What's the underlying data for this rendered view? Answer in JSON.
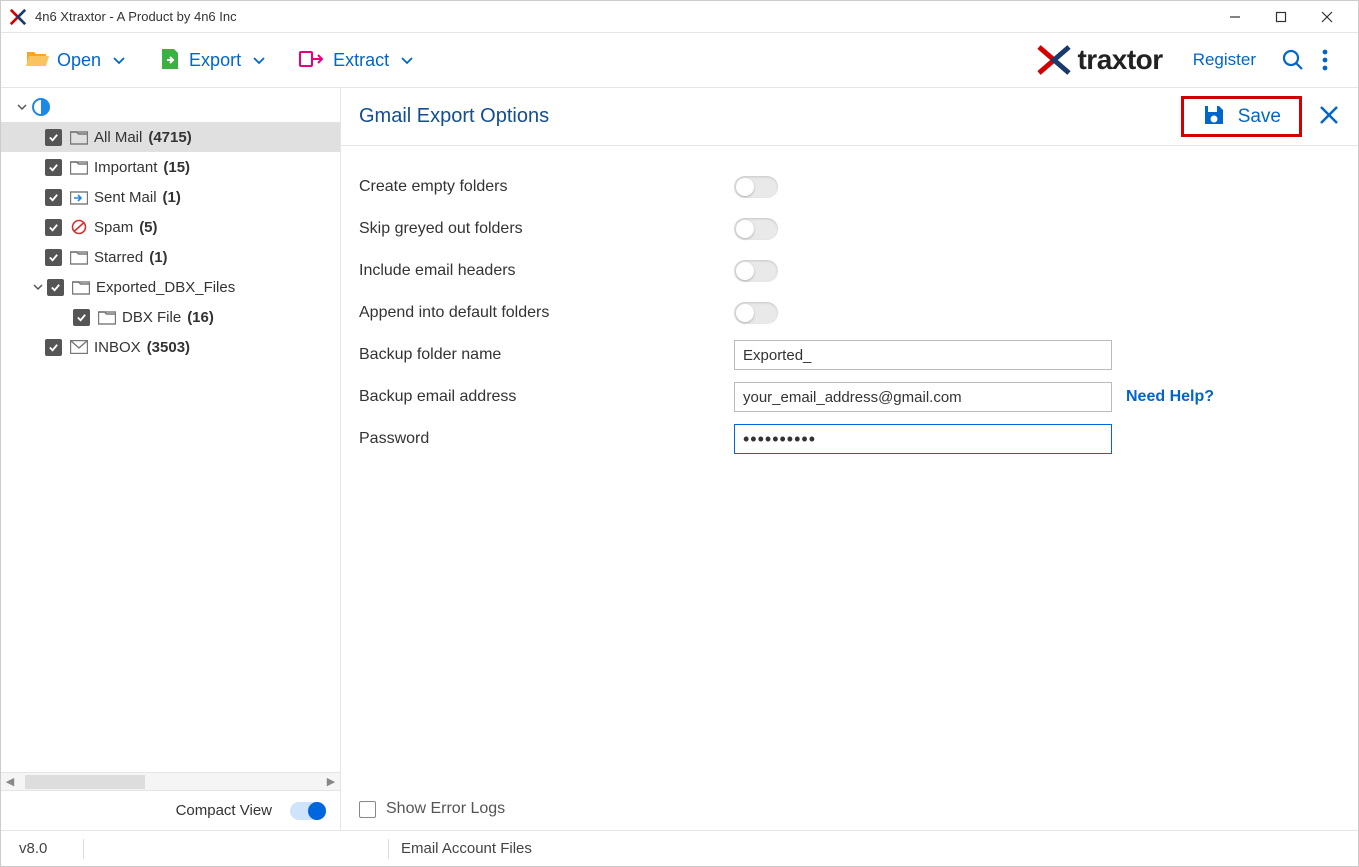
{
  "window": {
    "title": "4n6 Xtraxtor - A Product by 4n6 Inc"
  },
  "toolbar": {
    "open_label": "Open",
    "export_label": "Export",
    "extract_label": "Extract",
    "register_label": "Register",
    "logo_text": "traxtor"
  },
  "sidebar": {
    "items": [
      {
        "name": "All Mail",
        "count": "(4715)",
        "icon": "folder",
        "indent": 44,
        "caret": false,
        "selected": true
      },
      {
        "name": "Important",
        "count": "(15)",
        "icon": "folder",
        "indent": 44,
        "caret": false,
        "selected": false
      },
      {
        "name": "Sent Mail",
        "count": "(1)",
        "icon": "sent",
        "indent": 44,
        "caret": false,
        "selected": false
      },
      {
        "name": "Spam",
        "count": "(5)",
        "icon": "spam",
        "indent": 44,
        "caret": false,
        "selected": false
      },
      {
        "name": "Starred",
        "count": "(1)",
        "icon": "folder",
        "indent": 44,
        "caret": false,
        "selected": false
      },
      {
        "name": "Exported_DBX_Files",
        "count": "",
        "icon": "folder",
        "indent": 44,
        "caret": true,
        "selected": false
      },
      {
        "name": "DBX File",
        "count": "(16)",
        "icon": "folder",
        "indent": 72,
        "caret": false,
        "selected": false
      },
      {
        "name": "INBOX",
        "count": "(3503)",
        "icon": "inbox",
        "indent": 44,
        "caret": false,
        "selected": false
      }
    ],
    "compact_label": "Compact View"
  },
  "content": {
    "title": "Gmail Export Options",
    "save_label": "Save",
    "options": [
      {
        "label": "Create empty folders"
      },
      {
        "label": "Skip greyed out folders"
      },
      {
        "label": "Include email headers"
      },
      {
        "label": "Append into default folders"
      }
    ],
    "backup_folder_label": "Backup folder name",
    "backup_folder_value": "Exported_",
    "backup_email_label": "Backup email address",
    "backup_email_value": "your_email_address@gmail.com",
    "help_label": "Need Help?",
    "password_label": "Password",
    "password_value": "••••••••••",
    "show_error_logs_label": "Show Error Logs"
  },
  "status": {
    "version": "v8.0",
    "info": "Email Account Files"
  }
}
